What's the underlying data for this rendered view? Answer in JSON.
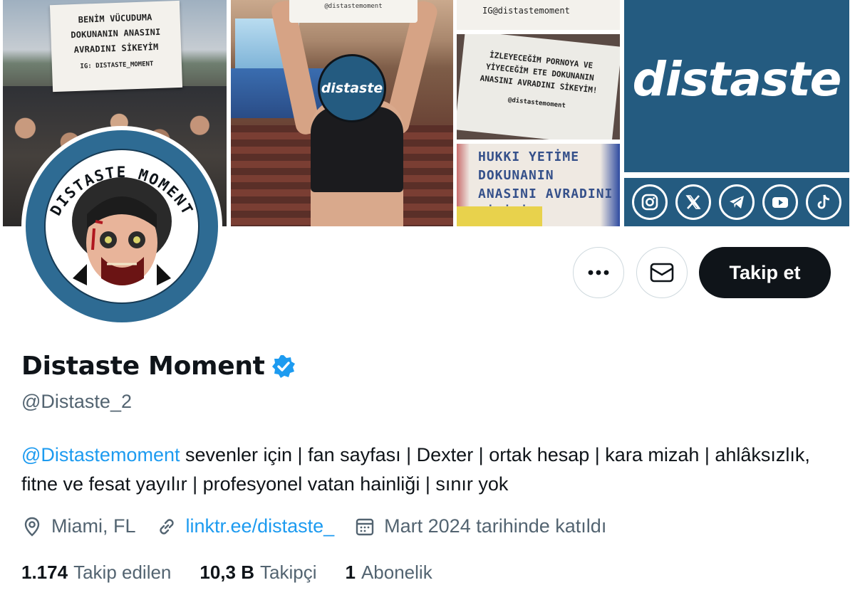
{
  "banner": {
    "sign_left_lines": [
      "BENİM VÜCUDUMA",
      "DOKUNANIN ANASINI",
      "AVRADINI SİKEYİM"
    ],
    "sign_left_tag": "IG: DISTASTE_MOMENT",
    "held_sign_tag": "@distastemoment",
    "sign_top_right": "IG@distastemoment",
    "sign_middle_lines": [
      "İZLEYECEĞİM PORNOYA VE",
      "YİYECEĞİM ETE DOKUNANIN",
      "ANASINI AVRADINI SİKEYİM!"
    ],
    "sign_middle_tag": "@distastemoment",
    "sign_bottom_lines": [
      "HUKKI YETİME",
      "DOKUNANIN",
      "ANASINI AVRADINI",
      "SİKİYİM"
    ],
    "face_logo_text": "distaste",
    "brand_text": "distaste",
    "social_icons": [
      "instagram-icon",
      "x-icon",
      "telegram-icon",
      "youtube-icon",
      "tiktok-icon"
    ],
    "brand_color": "#245b80"
  },
  "avatar": {
    "ring_text": "DISTASTE MOMENT",
    "ring_color": "#2e6b93"
  },
  "actions": {
    "more_icon": "more-icon",
    "message_icon": "mail-icon",
    "follow_label": "Takip et"
  },
  "profile": {
    "name": "Distaste Moment",
    "handle": "@Distaste_2",
    "bio_mention": "@Distastemoment",
    "bio_text": " sevenler için | fan sayfası | Dexter | ortak hesap | kara mizah | ahlâksızlık, fitne ve fesat yayılır | profesyonel vatan hainliği | sınır yok",
    "location": "Miami, FL",
    "link": "linktr.ee/distaste_",
    "joined": "Mart 2024 tarihinde katıldı"
  },
  "stats": {
    "following_count": "1.174",
    "following_label": "Takip edilen",
    "followers_count": "10,3 B",
    "followers_label": "Takipçi",
    "subscriptions_count": "1",
    "subscriptions_label": "Abonelik"
  },
  "colors": {
    "link": "#1d9bf0",
    "verified": "#1d9bf0",
    "muted_text": "#536471",
    "primary_button": "#0f1419"
  }
}
